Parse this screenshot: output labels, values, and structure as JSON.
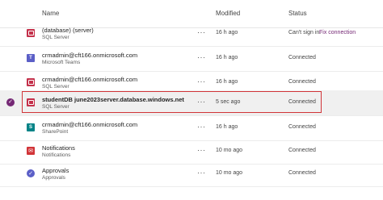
{
  "header": {
    "name": "Name",
    "modified": "Modified",
    "status": "Status"
  },
  "rows": [
    {
      "icon": "sql-server-icon",
      "name": "(database) (server)",
      "sub": "SQL Server",
      "more": "···",
      "modified": "16 h ago",
      "status": "Can't sign in.",
      "action": "Fix connection"
    },
    {
      "icon": "teams-icon",
      "name": "crmadmin@cft166.onmicrosoft.com",
      "sub": "Microsoft Teams",
      "more": "···",
      "modified": "16 h ago",
      "status": "Connected"
    },
    {
      "icon": "sql-server-icon",
      "name": "crmadmin@cft166.onmicrosoft.com",
      "sub": "SQL Server",
      "more": "···",
      "modified": "16 h ago",
      "status": "Connected"
    },
    {
      "icon": "sql-server-icon",
      "name": "studentDB june2023server.database.windows.net",
      "sub": "SQL Server",
      "more": "···",
      "modified": "5 sec ago",
      "status": "Connected",
      "selected": true
    },
    {
      "icon": "sharepoint-icon",
      "name": "crmadmin@cft166.onmicrosoft.com",
      "sub": "SharePoint",
      "more": "···",
      "modified": "16 h ago",
      "status": "Connected"
    },
    {
      "icon": "notifications-icon",
      "name": "Notifications",
      "sub": "Notifications",
      "more": "···",
      "modified": "10 mo ago",
      "status": "Connected"
    },
    {
      "icon": "approvals-icon",
      "name": "Approvals",
      "sub": "Approvals",
      "more": "···",
      "modified": "10 mo ago",
      "status": "Connected"
    }
  ],
  "colors": {
    "accent": "#742774",
    "highlight_border": "#d13438",
    "sql": "#c4314b",
    "teams": "#5b5fc7",
    "sharepoint": "#038387"
  }
}
